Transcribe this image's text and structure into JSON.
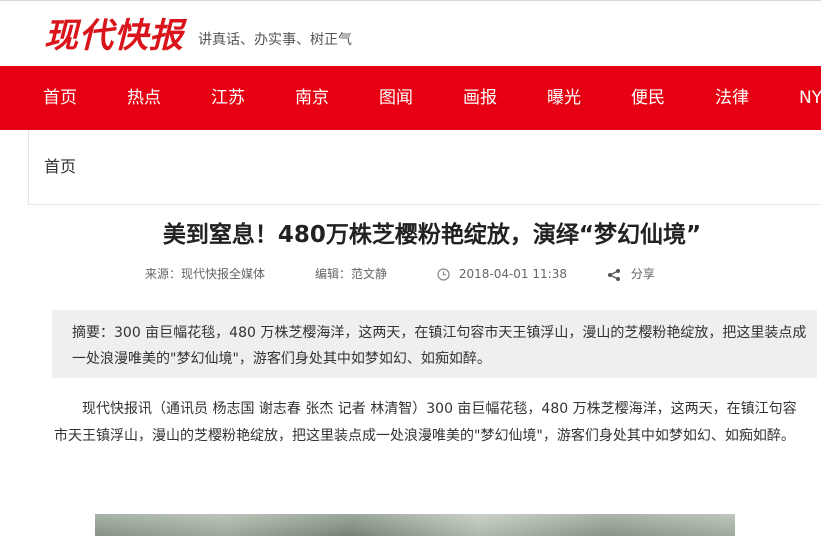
{
  "header": {
    "logo_text": "现代快报",
    "slogan": "讲真话、办实事、树正气"
  },
  "nav": {
    "items": [
      "首页",
      "热点",
      "江苏",
      "南京",
      "图闻",
      "画报",
      "曝光",
      "便民",
      "法律",
      "NY"
    ]
  },
  "breadcrumb": {
    "label": "首页"
  },
  "article": {
    "title": "美到窒息！480万株芝樱粉艳绽放，演绎“梦幻仙境”",
    "source": "来源：现代快报全媒体",
    "editor": "编辑：范文静",
    "datetime": "2018-04-01 11:38",
    "share_label": "分享",
    "summary": "摘要：300 亩巨幅花毯，480 万株芝樱海洋，这两天，在镇江句容市天王镇浮山，漫山的芝樱粉艳绽放，把这里装点成一处浪漫唯美的\"梦幻仙境\"，游客们身处其中如梦如幻、如痴如醉。",
    "body": "现代快报讯（通讯员 杨志国 谢志春 张杰 记者 林清智）300 亩巨幅花毯，480 万株芝樱海洋，这两天，在镇江句容市天王镇浮山，漫山的芝樱粉艳绽放，把这里装点成一处浪漫唯美的\"梦幻仙境\"，游客们身处其中如梦如幻、如痴如醉。"
  },
  "colors": {
    "brand_red": "#e60012",
    "logo_red": "#d9141b",
    "summary_bg": "#efefef"
  },
  "icons": {
    "clock": "clock-icon",
    "share": "share-icon"
  }
}
